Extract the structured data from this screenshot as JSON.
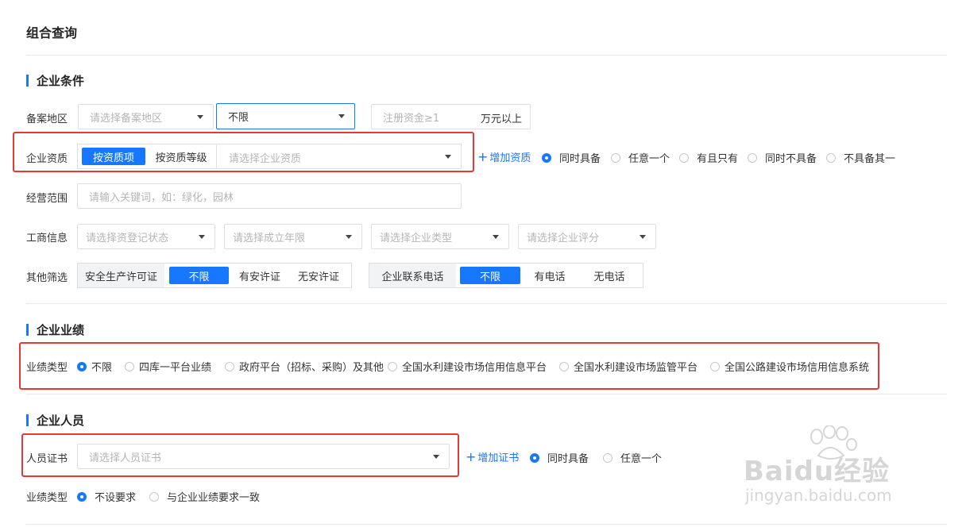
{
  "page_title": "组合查询",
  "sections": {
    "company": "企业条件",
    "performance": "企业业绩",
    "personnel": "企业人员"
  },
  "region": {
    "label": "备案地区",
    "placeholder": "请选择备案地区",
    "second_value": "不限",
    "capital_placeholder": "注册资金≥1",
    "capital_unit": "万元以上"
  },
  "qualification": {
    "label": "企业资质",
    "mode_item": "按资质项",
    "mode_level": "按资质等级",
    "placeholder": "请选择企业资质",
    "add_link": "增加资质",
    "options": [
      "同时具备",
      "任意一个",
      "有且只有",
      "同时不具备",
      "不具备其一"
    ],
    "selected": 0
  },
  "scope": {
    "label": "经营范围",
    "placeholder": "请输入关键词，如：绿化，园林"
  },
  "business": {
    "label": "工商信息",
    "placeholders": [
      "请选择资登记状态",
      "请选择成立年限",
      "请选择企业类型",
      "请选择企业评分"
    ]
  },
  "other": {
    "label": "其他筛选",
    "safety_label": "安全生产许可证",
    "safety_options": [
      "不限",
      "有安许证",
      "无安许证"
    ],
    "phone_label": "企业联系电话",
    "phone_options": [
      "不限",
      "有电话",
      "无电话"
    ]
  },
  "perf": {
    "label": "业绩类型",
    "options": [
      "不限",
      "四库一平台业绩",
      "政府平台（招标、采购）及其他",
      "全国水利建设市场信用信息平台",
      "全国水利建设市场监管平台",
      "全国公路建设市场信用信息系统"
    ],
    "selected": 0
  },
  "person": {
    "label": "人员证书",
    "placeholder": "请选择人员证书",
    "add_link": "增加证书",
    "options": [
      "同时具备",
      "任意一个"
    ],
    "selected": 0,
    "perf_label": "业绩类型",
    "perf_options": [
      "不设要求",
      "与企业业绩要求一致"
    ],
    "perf_selected": 0
  },
  "watermark": {
    "brand": "Baidu经验",
    "url": "jingyan.baidu.com"
  },
  "colors": {
    "accent": "#1677ff",
    "highlight": "#e53935"
  }
}
